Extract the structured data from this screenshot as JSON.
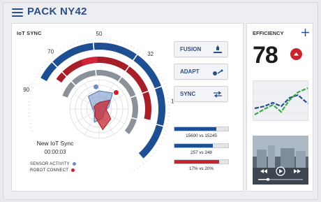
{
  "header": {
    "title": "PACK  NY42",
    "menu_icon": "menu-icon"
  },
  "iot": {
    "label": "IoT SYNC",
    "dial_ticks": [
      "90",
      "70",
      "50",
      "32",
      "10"
    ],
    "sync_title": "New IoT Sync",
    "sync_time": "00:00:03",
    "legend": [
      {
        "label": "SENSOR ACTIVITY",
        "color": "#6b8fc4"
      },
      {
        "label": "ROBOT CONNECT",
        "color": "#c8242e"
      }
    ],
    "buttons": [
      {
        "label": "FUSION",
        "icon": "fusion-icon"
      },
      {
        "label": "ADAPT",
        "icon": "adapt-icon"
      },
      {
        "label": "SYNC",
        "icon": "sync-icon"
      }
    ],
    "bars": [
      {
        "text": "15600 vs 15245",
        "fill": 0.78,
        "color": "#1f4f93"
      },
      {
        "text": "257 vs 248",
        "fill": 0.72,
        "color": "#1f4f93"
      },
      {
        "text": "17% vs 20%",
        "fill": 0.83,
        "color": "#c8242e"
      }
    ]
  },
  "efficiency": {
    "label": "EFFICIENCY",
    "value": "78",
    "trend_icon": "arrow-up-icon",
    "colors": {
      "primary": "#1f4f93",
      "accent": "#c8242e",
      "green": "#3ea64a"
    }
  },
  "video": {
    "controls": [
      "rewind-icon",
      "play-icon",
      "forward-icon",
      "progress-slider"
    ]
  }
}
